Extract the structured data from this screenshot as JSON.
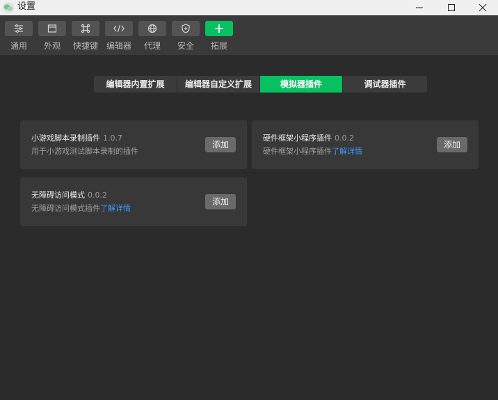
{
  "window": {
    "title": "设置",
    "controls": [
      "minimize",
      "maximize",
      "close"
    ]
  },
  "toolbar": {
    "items": [
      {
        "label": "通用",
        "icon": "sliders-icon"
      },
      {
        "label": "外观",
        "icon": "window-icon"
      },
      {
        "label": "快捷键",
        "icon": "command-icon"
      },
      {
        "label": "编辑器",
        "icon": "code-icon"
      },
      {
        "label": "代理",
        "icon": "globe-icon"
      },
      {
        "label": "安全",
        "icon": "shield-icon"
      },
      {
        "label": "拓展",
        "icon": "plus-icon",
        "active": true
      }
    ]
  },
  "tabs": [
    {
      "label": "编辑器内置扩展"
    },
    {
      "label": "编辑器自定义扩展"
    },
    {
      "label": "模拟器插件",
      "active": true
    },
    {
      "label": "调试器插件"
    }
  ],
  "plugins": [
    {
      "name": "小游戏脚本录制插件",
      "version": "1.0.7",
      "desc": "用于小游戏测试脚本录制的插件",
      "link": "",
      "button": "添加"
    },
    {
      "name": "硬件框架小程序插件",
      "version": "0.0.2",
      "desc": "硬件框架小程序插件",
      "link": "了解详情",
      "button": "添加"
    },
    {
      "name": "无障碍访问模式",
      "version": "0.0.2",
      "desc": "无障碍访问模式插件",
      "link": "了解详情",
      "button": "添加"
    }
  ],
  "colors": {
    "accent": "#07c160",
    "link": "#3b99fc",
    "background": "#2b2b2b",
    "toolbar": "#3a3a3a",
    "card": "#383838"
  }
}
